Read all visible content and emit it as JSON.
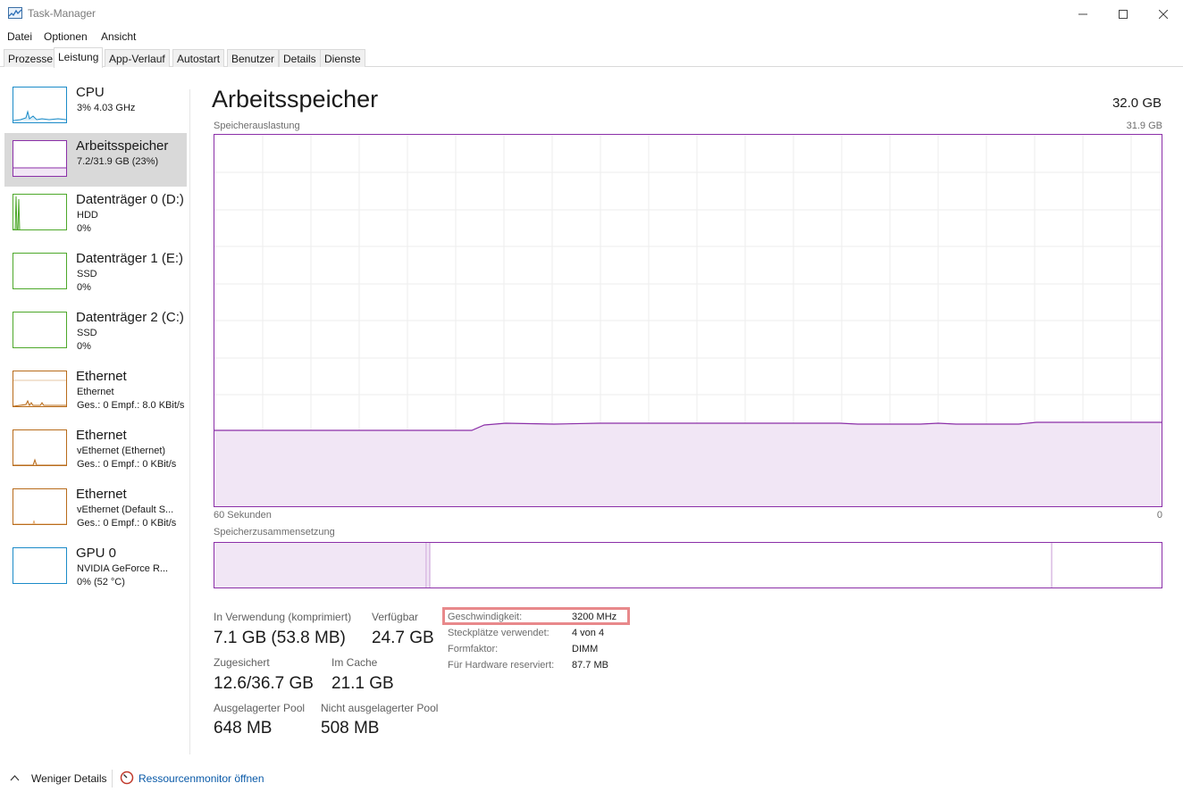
{
  "window": {
    "title": "Task-Manager"
  },
  "menu": [
    "Datei",
    "Optionen",
    "Ansicht"
  ],
  "tabs": [
    "Prozesse",
    "Leistung",
    "App-Verlauf",
    "Autostart",
    "Benutzer",
    "Details",
    "Dienste"
  ],
  "active_tab": "Leistung",
  "colors": {
    "memory": "#8b2fa8",
    "cpu": "#1b8bc8",
    "disk": "#4da82a",
    "ethernet": "#b86b1a",
    "gpu": "#1b8bc8",
    "highlight": "#e8898b",
    "selected_bg": "#d9d9d9"
  },
  "sidebar": {
    "items": [
      {
        "title": "CPU",
        "line1": "3% 4.03 GHz",
        "line2": ""
      },
      {
        "title": "Arbeitsspeicher",
        "line1": "7.2/31.9 GB (23%)",
        "line2": ""
      },
      {
        "title": "Datenträger 0 (D:)",
        "line1": "HDD",
        "line2": "0%"
      },
      {
        "title": "Datenträger 1 (E:)",
        "line1": "SSD",
        "line2": "0%"
      },
      {
        "title": "Datenträger 2 (C:)",
        "line1": "SSD",
        "line2": "0%"
      },
      {
        "title": "Ethernet",
        "line1": "Ethernet",
        "line2": "Ges.: 0 Empf.: 8.0 KBit/s"
      },
      {
        "title": "Ethernet",
        "line1": "vEthernet (Ethernet)",
        "line2": "Ges.: 0 Empf.: 0 KBit/s"
      },
      {
        "title": "Ethernet",
        "line1": "vEthernet (Default S...",
        "line2": "Ges.: 0 Empf.: 0 KBit/s"
      },
      {
        "title": "GPU 0",
        "line1": "NVIDIA GeForce R...",
        "line2": "0% (52 °C)"
      }
    ]
  },
  "main": {
    "title": "Arbeitsspeicher",
    "total": "32.0 GB",
    "usage_label": "Speicherauslastung",
    "usage_max": "31.9 GB",
    "time_left": "60 Sekunden",
    "time_right": "0",
    "composition_label": "Speicherzusammensetzung",
    "stats": {
      "in_use_label": "In Verwendung (komprimiert)",
      "in_use_value": "7.1 GB (53.8 MB)",
      "available_label": "Verfügbar",
      "available_value": "24.7 GB",
      "committed_label": "Zugesichert",
      "committed_value": "12.6/36.7 GB",
      "cached_label": "Im Cache",
      "cached_value": "21.1 GB",
      "paged_label": "Ausgelagerter Pool",
      "paged_value": "648 MB",
      "nonpaged_label": "Nicht ausgelagerter Pool",
      "nonpaged_value": "508 MB"
    },
    "properties": [
      {
        "label": "Geschwindigkeit:",
        "value": "3200 MHz"
      },
      {
        "label": "Steckplätze verwendet:",
        "value": "4 von 4"
      },
      {
        "label": "Formfaktor:",
        "value": "DIMM"
      },
      {
        "label": "Für Hardware reserviert:",
        "value": "87.7 MB"
      }
    ]
  },
  "footer": {
    "fewer_details": "Weniger Details",
    "resource_monitor": "Ressourcenmonitor öffnen"
  }
}
